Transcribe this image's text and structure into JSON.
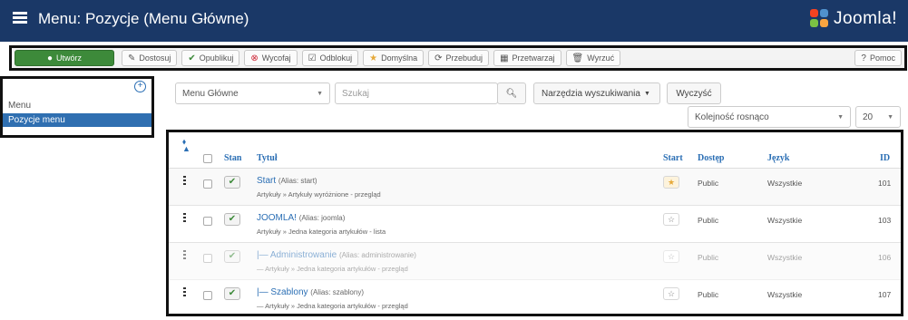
{
  "header": {
    "title": "Menu: Pozycje (Menu Główne)",
    "logo_text": "Joomla!"
  },
  "toolbar": {
    "create": "Utwórz",
    "edit": "Dostosuj",
    "publish": "Opublikuj",
    "unpublish": "Wycofaj",
    "checkin": "Odblokuj",
    "default": "Domyślna",
    "rebuild": "Przebuduj",
    "batch": "Przetwarzaj",
    "trash": "Wyrzuć",
    "help": "Pomoc"
  },
  "sidebar": {
    "items": [
      {
        "label": "Menu"
      },
      {
        "label": "Pozycje menu"
      }
    ]
  },
  "filters": {
    "menu_select": "Menu Główne",
    "search_placeholder": "Szukaj",
    "search_tools": "Narzędzia wyszukiwania",
    "clear": "Wyczyść",
    "ordering": "Kolejność rosnąco",
    "limit": "20"
  },
  "table": {
    "headers": {
      "stan": "Stan",
      "tytul": "Tytuł",
      "start": "Start",
      "dostep": "Dostęp",
      "jezyk": "Język",
      "id": "ID"
    },
    "rows": [
      {
        "title": "Start",
        "alias": "(Alias: start)",
        "sub": "Artykuły » Artykuły wyróżnione - przegląd",
        "access": "Public",
        "language": "Wszystkie",
        "id": "101",
        "home": true,
        "dim": false
      },
      {
        "title": "JOOMLA!",
        "alias": "(Alias: joomla)",
        "sub": "Artykuły » Jedna kategoria artykułów - lista",
        "access": "Public",
        "language": "Wszystkie",
        "id": "103",
        "home": false,
        "dim": false
      },
      {
        "title": "|— Administrowanie",
        "alias": "(Alias: administrowanie)",
        "sub": "— Artykuły » Jedna kategoria artykułów - przegląd",
        "access": "Public",
        "language": "Wszystkie",
        "id": "106",
        "home": false,
        "dim": true
      },
      {
        "title": "|— Szablony",
        "alias": "(Alias: szablony)",
        "sub": "— Artykuły » Jedna kategoria artykułów - przegląd",
        "access": "Public",
        "language": "Wszystkie",
        "id": "107",
        "home": false,
        "dim": false
      }
    ]
  },
  "colors": {
    "header_bg": "#1a3867",
    "create_btn": "#3d8a3a",
    "link": "#2a6eb4",
    "active_sidebar": "#2f6fb1"
  }
}
